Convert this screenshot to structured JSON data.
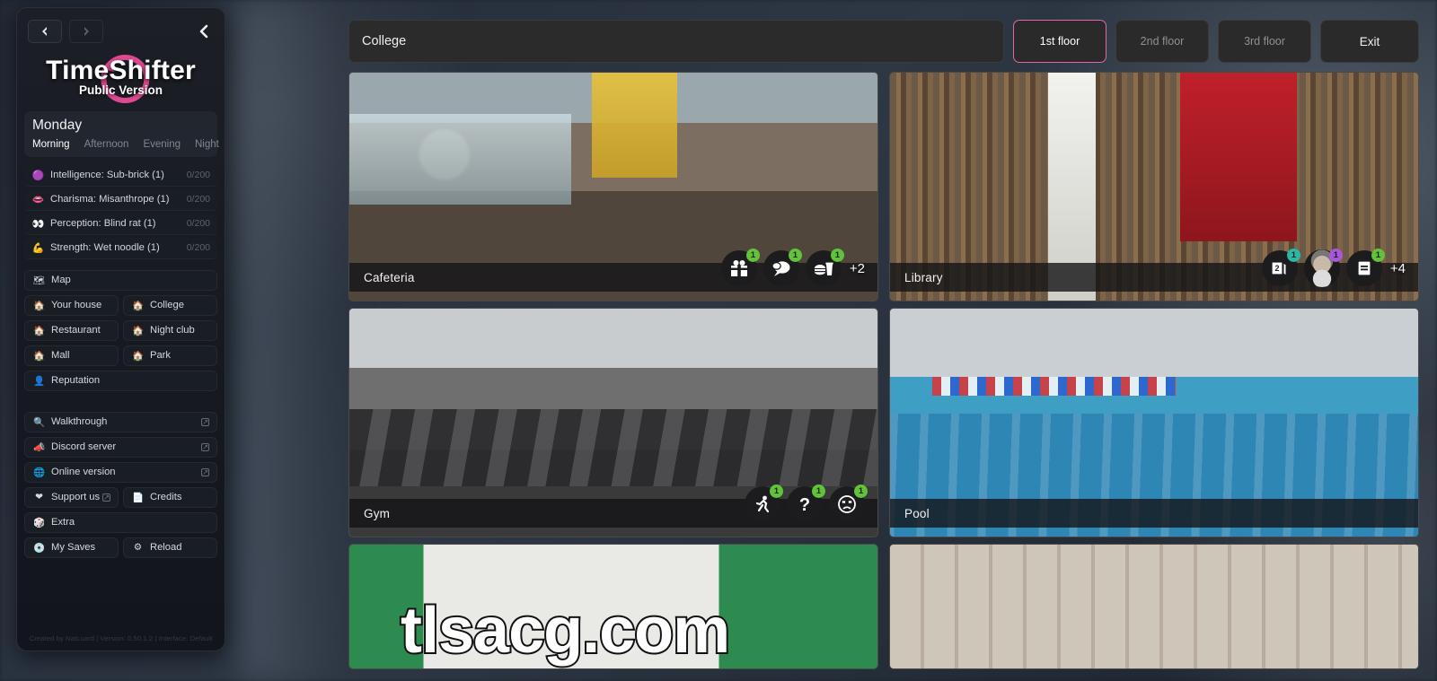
{
  "app": {
    "title_main": "TimeShifter",
    "title_sub": "Public Version"
  },
  "sidebar": {
    "nav": {
      "back_icon": "arrow-left-icon",
      "forward_icon": "arrow-right-icon",
      "collapse_icon": "chevron-left-icon"
    },
    "day": {
      "name": "Monday",
      "phases": [
        "Morning",
        "Afternoon",
        "Evening",
        "Night"
      ],
      "active_phase": "Morning"
    },
    "stats": [
      {
        "icon": "pink-circle-icon",
        "label": "Intelligence: Sub-brick (1)",
        "value": "0/200"
      },
      {
        "icon": "pink-lips-icon",
        "label": "Charisma: Misanthrope (1)",
        "value": "0/200"
      },
      {
        "icon": "eyes-icon",
        "label": "Perception: Blind rat (1)",
        "value": "0/200"
      },
      {
        "icon": "muscle-icon",
        "label": "Strength: Wet noodle (1)",
        "value": "0/200"
      }
    ],
    "map_button": {
      "icon": "map-icon",
      "label": "Map"
    },
    "places": [
      {
        "icon": "house-icon",
        "label": "Your house"
      },
      {
        "icon": "house-icon",
        "label": "College"
      },
      {
        "icon": "house-icon",
        "label": "Restaurant"
      },
      {
        "icon": "house-icon",
        "label": "Night club"
      },
      {
        "icon": "house-icon",
        "label": "Mall"
      },
      {
        "icon": "house-icon",
        "label": "Park"
      }
    ],
    "reputation_button": {
      "icon": "person-icon",
      "label": "Reputation"
    },
    "links": [
      {
        "icon": "magnifier-icon",
        "label": "Walkthrough",
        "external": "↗"
      },
      {
        "icon": "discord-icon",
        "label": "Discord server",
        "external": "↗"
      },
      {
        "icon": "globe-icon",
        "label": "Online version",
        "external": "↗"
      }
    ],
    "support_button": {
      "icon": "heart-icon",
      "label": "Support us",
      "external": "↗"
    },
    "credits_button": {
      "icon": "document-icon",
      "label": "Credits"
    },
    "extra_button": {
      "icon": "dice-icon",
      "label": "Extra"
    },
    "saves_button": {
      "icon": "disc-icon",
      "label": "My Saves"
    },
    "reload_button": {
      "icon": "gear-icon",
      "label": "Reload"
    },
    "footer": "Created by NatLuard | Version: 0.50.1.2 | Interface: Default"
  },
  "topbar": {
    "location": "College",
    "floors": [
      {
        "label": "1st floor",
        "active": true
      },
      {
        "label": "2nd floor",
        "active": false
      },
      {
        "label": "3rd floor",
        "active": false
      }
    ],
    "exit_label": "Exit"
  },
  "colors": {
    "accent_pink": "#e0689f",
    "badge_green": "#62c23a",
    "badge_teal": "#2bb6a8",
    "badge_purple": "#a857d8"
  },
  "cards": [
    {
      "name": "Cafeteria",
      "scene": "cafe",
      "more": "+2",
      "badges": [
        {
          "icon": "gift-icon",
          "count": "1",
          "color": "#62c23a"
        },
        {
          "icon": "speech-bubble-icon",
          "count": "1",
          "color": "#62c23a"
        },
        {
          "icon": "burger-drink-icon",
          "count": "1",
          "color": "#62c23a"
        }
      ]
    },
    {
      "name": "Library",
      "scene": "lib",
      "more": "+4",
      "badges": [
        {
          "icon": "books-stack-icon",
          "count": "1",
          "color": "#2bb6a8"
        },
        {
          "icon": "portrait-icon",
          "count": "1",
          "color": "#a857d8"
        },
        {
          "icon": "book-icon",
          "count": "1",
          "color": "#62c23a"
        }
      ]
    },
    {
      "name": "Gym",
      "scene": "gym",
      "more": "",
      "badges": [
        {
          "icon": "running-person-icon",
          "count": "1",
          "color": "#62c23a"
        },
        {
          "icon": "question-mark-icon",
          "count": "1",
          "color": "#62c23a"
        },
        {
          "icon": "sad-face-icon",
          "count": "1",
          "color": "#62c23a"
        }
      ]
    },
    {
      "name": "Pool",
      "scene": "pool",
      "more": "",
      "badges": []
    }
  ],
  "watermark": "tlsacg.com"
}
